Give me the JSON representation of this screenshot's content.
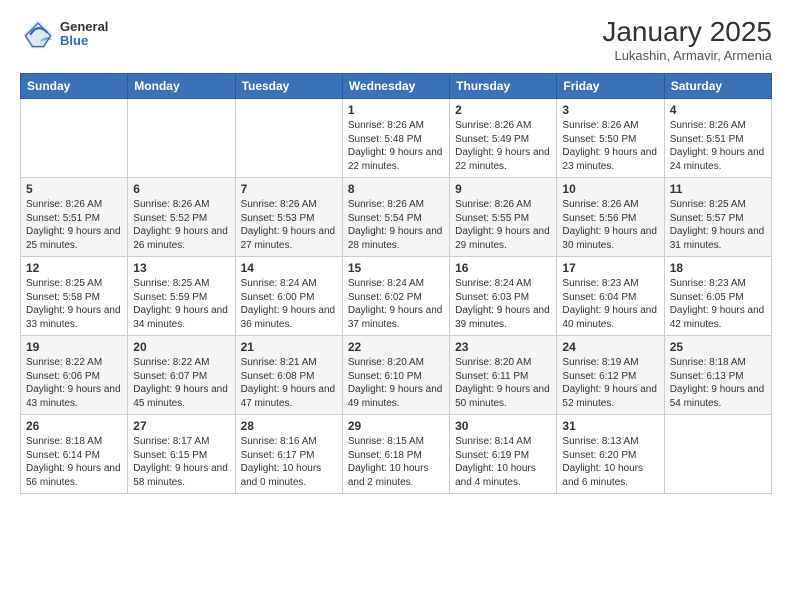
{
  "header": {
    "logo_general": "General",
    "logo_blue": "Blue",
    "month_title": "January 2025",
    "location": "Lukashin, Armavir, Armenia"
  },
  "days_of_week": [
    "Sunday",
    "Monday",
    "Tuesday",
    "Wednesday",
    "Thursday",
    "Friday",
    "Saturday"
  ],
  "weeks": [
    [
      {
        "num": "",
        "sunrise": "",
        "sunset": "",
        "daylight": ""
      },
      {
        "num": "",
        "sunrise": "",
        "sunset": "",
        "daylight": ""
      },
      {
        "num": "",
        "sunrise": "",
        "sunset": "",
        "daylight": ""
      },
      {
        "num": "1",
        "sunrise": "Sunrise: 8:26 AM",
        "sunset": "Sunset: 5:48 PM",
        "daylight": "Daylight: 9 hours and 22 minutes."
      },
      {
        "num": "2",
        "sunrise": "Sunrise: 8:26 AM",
        "sunset": "Sunset: 5:49 PM",
        "daylight": "Daylight: 9 hours and 22 minutes."
      },
      {
        "num": "3",
        "sunrise": "Sunrise: 8:26 AM",
        "sunset": "Sunset: 5:50 PM",
        "daylight": "Daylight: 9 hours and 23 minutes."
      },
      {
        "num": "4",
        "sunrise": "Sunrise: 8:26 AM",
        "sunset": "Sunset: 5:51 PM",
        "daylight": "Daylight: 9 hours and 24 minutes."
      }
    ],
    [
      {
        "num": "5",
        "sunrise": "Sunrise: 8:26 AM",
        "sunset": "Sunset: 5:51 PM",
        "daylight": "Daylight: 9 hours and 25 minutes."
      },
      {
        "num": "6",
        "sunrise": "Sunrise: 8:26 AM",
        "sunset": "Sunset: 5:52 PM",
        "daylight": "Daylight: 9 hours and 26 minutes."
      },
      {
        "num": "7",
        "sunrise": "Sunrise: 8:26 AM",
        "sunset": "Sunset: 5:53 PM",
        "daylight": "Daylight: 9 hours and 27 minutes."
      },
      {
        "num": "8",
        "sunrise": "Sunrise: 8:26 AM",
        "sunset": "Sunset: 5:54 PM",
        "daylight": "Daylight: 9 hours and 28 minutes."
      },
      {
        "num": "9",
        "sunrise": "Sunrise: 8:26 AM",
        "sunset": "Sunset: 5:55 PM",
        "daylight": "Daylight: 9 hours and 29 minutes."
      },
      {
        "num": "10",
        "sunrise": "Sunrise: 8:26 AM",
        "sunset": "Sunset: 5:56 PM",
        "daylight": "Daylight: 9 hours and 30 minutes."
      },
      {
        "num": "11",
        "sunrise": "Sunrise: 8:25 AM",
        "sunset": "Sunset: 5:57 PM",
        "daylight": "Daylight: 9 hours and 31 minutes."
      }
    ],
    [
      {
        "num": "12",
        "sunrise": "Sunrise: 8:25 AM",
        "sunset": "Sunset: 5:58 PM",
        "daylight": "Daylight: 9 hours and 33 minutes."
      },
      {
        "num": "13",
        "sunrise": "Sunrise: 8:25 AM",
        "sunset": "Sunset: 5:59 PM",
        "daylight": "Daylight: 9 hours and 34 minutes."
      },
      {
        "num": "14",
        "sunrise": "Sunrise: 8:24 AM",
        "sunset": "Sunset: 6:00 PM",
        "daylight": "Daylight: 9 hours and 36 minutes."
      },
      {
        "num": "15",
        "sunrise": "Sunrise: 8:24 AM",
        "sunset": "Sunset: 6:02 PM",
        "daylight": "Daylight: 9 hours and 37 minutes."
      },
      {
        "num": "16",
        "sunrise": "Sunrise: 8:24 AM",
        "sunset": "Sunset: 6:03 PM",
        "daylight": "Daylight: 9 hours and 39 minutes."
      },
      {
        "num": "17",
        "sunrise": "Sunrise: 8:23 AM",
        "sunset": "Sunset: 6:04 PM",
        "daylight": "Daylight: 9 hours and 40 minutes."
      },
      {
        "num": "18",
        "sunrise": "Sunrise: 8:23 AM",
        "sunset": "Sunset: 6:05 PM",
        "daylight": "Daylight: 9 hours and 42 minutes."
      }
    ],
    [
      {
        "num": "19",
        "sunrise": "Sunrise: 8:22 AM",
        "sunset": "Sunset: 6:06 PM",
        "daylight": "Daylight: 9 hours and 43 minutes."
      },
      {
        "num": "20",
        "sunrise": "Sunrise: 8:22 AM",
        "sunset": "Sunset: 6:07 PM",
        "daylight": "Daylight: 9 hours and 45 minutes."
      },
      {
        "num": "21",
        "sunrise": "Sunrise: 8:21 AM",
        "sunset": "Sunset: 6:08 PM",
        "daylight": "Daylight: 9 hours and 47 minutes."
      },
      {
        "num": "22",
        "sunrise": "Sunrise: 8:20 AM",
        "sunset": "Sunset: 6:10 PM",
        "daylight": "Daylight: 9 hours and 49 minutes."
      },
      {
        "num": "23",
        "sunrise": "Sunrise: 8:20 AM",
        "sunset": "Sunset: 6:11 PM",
        "daylight": "Daylight: 9 hours and 50 minutes."
      },
      {
        "num": "24",
        "sunrise": "Sunrise: 8:19 AM",
        "sunset": "Sunset: 6:12 PM",
        "daylight": "Daylight: 9 hours and 52 minutes."
      },
      {
        "num": "25",
        "sunrise": "Sunrise: 8:18 AM",
        "sunset": "Sunset: 6:13 PM",
        "daylight": "Daylight: 9 hours and 54 minutes."
      }
    ],
    [
      {
        "num": "26",
        "sunrise": "Sunrise: 8:18 AM",
        "sunset": "Sunset: 6:14 PM",
        "daylight": "Daylight: 9 hours and 56 minutes."
      },
      {
        "num": "27",
        "sunrise": "Sunrise: 8:17 AM",
        "sunset": "Sunset: 6:15 PM",
        "daylight": "Daylight: 9 hours and 58 minutes."
      },
      {
        "num": "28",
        "sunrise": "Sunrise: 8:16 AM",
        "sunset": "Sunset: 6:17 PM",
        "daylight": "Daylight: 10 hours and 0 minutes."
      },
      {
        "num": "29",
        "sunrise": "Sunrise: 8:15 AM",
        "sunset": "Sunset: 6:18 PM",
        "daylight": "Daylight: 10 hours and 2 minutes."
      },
      {
        "num": "30",
        "sunrise": "Sunrise: 8:14 AM",
        "sunset": "Sunset: 6:19 PM",
        "daylight": "Daylight: 10 hours and 4 minutes."
      },
      {
        "num": "31",
        "sunrise": "Sunrise: 8:13 AM",
        "sunset": "Sunset: 6:20 PM",
        "daylight": "Daylight: 10 hours and 6 minutes."
      },
      {
        "num": "",
        "sunrise": "",
        "sunset": "",
        "daylight": ""
      }
    ]
  ]
}
